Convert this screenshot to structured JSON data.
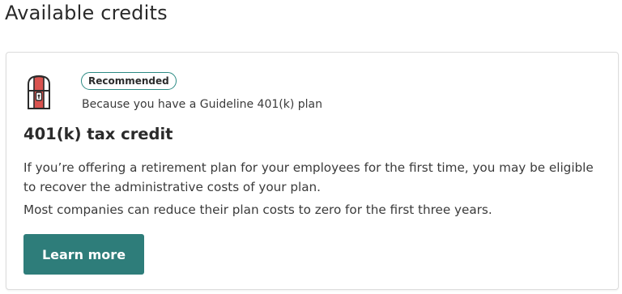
{
  "page": {
    "section_title": "Available credits"
  },
  "card": {
    "icon": "treasure-chest-lock-icon",
    "badge": "Recommended",
    "reason": "Because you have a Guideline 401(k) plan",
    "title": "401(k) tax credit",
    "description_1": "If you’re offering a retirement plan for your employees for the first time, you may be eligible to recover the administrative costs of your plan.",
    "description_2": "Most companies can reduce their plan costs to zero for the first three years.",
    "button_label": "Learn more"
  },
  "colors": {
    "accent": "#2e7d7a",
    "badge_border": "#2b8a83",
    "icon_red": "#d9534f",
    "icon_outline": "#2b2b2b"
  }
}
